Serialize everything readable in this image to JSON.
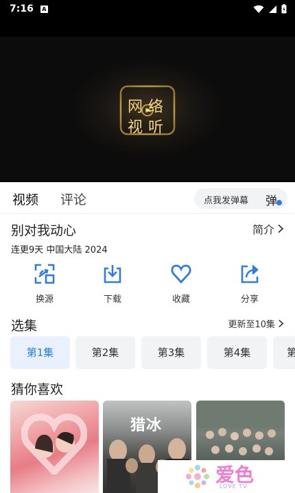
{
  "status_bar": {
    "time": "7:16",
    "notification_letter": "A"
  },
  "video": {
    "logo_line1": "网络",
    "logo_line2": "视听"
  },
  "tabs": [
    {
      "label": "视频"
    },
    {
      "label": "评论"
    }
  ],
  "danmu": {
    "placeholder": "点我发弹幕",
    "icon_char": "弹"
  },
  "show": {
    "title": "别对我动心",
    "intro_label": "简介",
    "meta": "连更9天 中国大陆 2024"
  },
  "actions": [
    {
      "label": "换源",
      "icon": "switch-source-icon"
    },
    {
      "label": "下载",
      "icon": "download-icon"
    },
    {
      "label": "收藏",
      "icon": "heart-icon"
    },
    {
      "label": "分享",
      "icon": "share-icon"
    }
  ],
  "episodes": {
    "title": "选集",
    "update_text": "更新至10集",
    "items": [
      {
        "label": "第1集",
        "active": true
      },
      {
        "label": "第2集"
      },
      {
        "label": "第3集"
      },
      {
        "label": "第4集"
      },
      {
        "label": "第"
      }
    ]
  },
  "recommend": {
    "title": "猜你喜欢",
    "poster2_title": "猎冰"
  },
  "watermark": {
    "text": "爱色",
    "sub": "LOVE TV"
  },
  "colors": {
    "accent": "#2d7be5",
    "background": "#ffffff",
    "chip_bg": "#f2f3f5",
    "active_chip_bg": "#e8f1fd"
  }
}
